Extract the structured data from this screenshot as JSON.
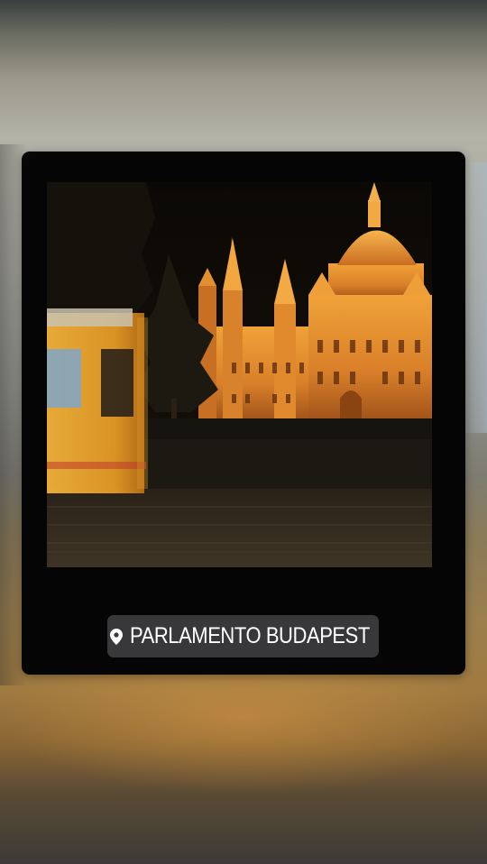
{
  "story": {
    "location_sticker": {
      "icon": "location-pin-icon",
      "label": "PARLAMENTO BUDAPEST"
    },
    "photo": {
      "subject": "Hungarian Parliament Building at night with passing yellow tram"
    },
    "colors": {
      "card": "#050505",
      "sticker_background": "#38383a",
      "sticker_text": "#ffffff",
      "building_glow": "#e8922a",
      "tram_yellow": "#e9a227"
    }
  }
}
